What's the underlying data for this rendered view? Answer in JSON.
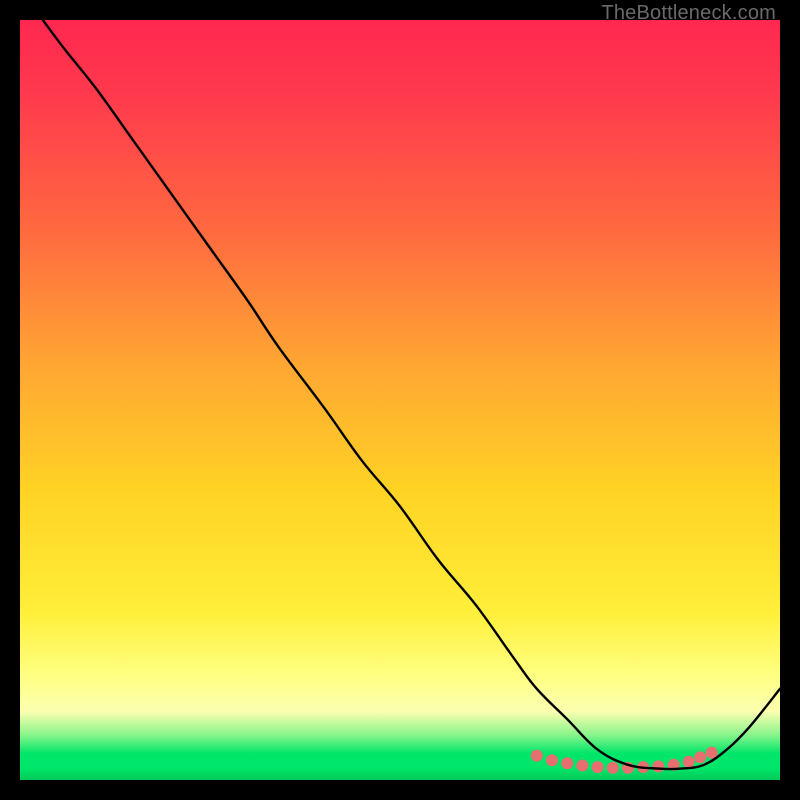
{
  "watermark": "TheBottleneck.com",
  "chart_data": {
    "type": "line",
    "title": "",
    "xlabel": "",
    "ylabel": "",
    "xlim": [
      0,
      100
    ],
    "ylim": [
      0,
      100
    ],
    "grid": false,
    "legend": false,
    "background_gradient": {
      "stops": [
        {
          "pos": 0,
          "color": "#ff2850"
        },
        {
          "pos": 0.45,
          "color": "#ffa533"
        },
        {
          "pos": 0.78,
          "color": "#ffef3a"
        },
        {
          "pos": 0.95,
          "color": "#00e66a"
        },
        {
          "pos": 1.0,
          "color": "#00c957"
        }
      ]
    },
    "series": [
      {
        "name": "bottleneck-curve",
        "color": "#000000",
        "x": [
          3,
          6,
          10,
          15,
          20,
          25,
          30,
          34,
          40,
          45,
          50,
          55,
          60,
          65,
          68,
          72,
          76,
          80,
          84,
          87,
          90,
          93,
          96,
          100
        ],
        "y": [
          100,
          96,
          91,
          84,
          77,
          70,
          63,
          57,
          49,
          42,
          36,
          29,
          23,
          16,
          12,
          8,
          4,
          2,
          1.5,
          1.5,
          2,
          4,
          7,
          12
        ]
      }
    ],
    "highlight": {
      "name": "valley-dots",
      "color": "#e76f6f",
      "radius_px": 6,
      "points_x": [
        68,
        70,
        72,
        74,
        76,
        78,
        80,
        82,
        84,
        86,
        88,
        89.5,
        91
      ],
      "points_y": [
        3.2,
        2.6,
        2.2,
        1.9,
        1.7,
        1.6,
        1.6,
        1.7,
        1.8,
        2.0,
        2.4,
        3.0,
        3.6
      ]
    }
  }
}
